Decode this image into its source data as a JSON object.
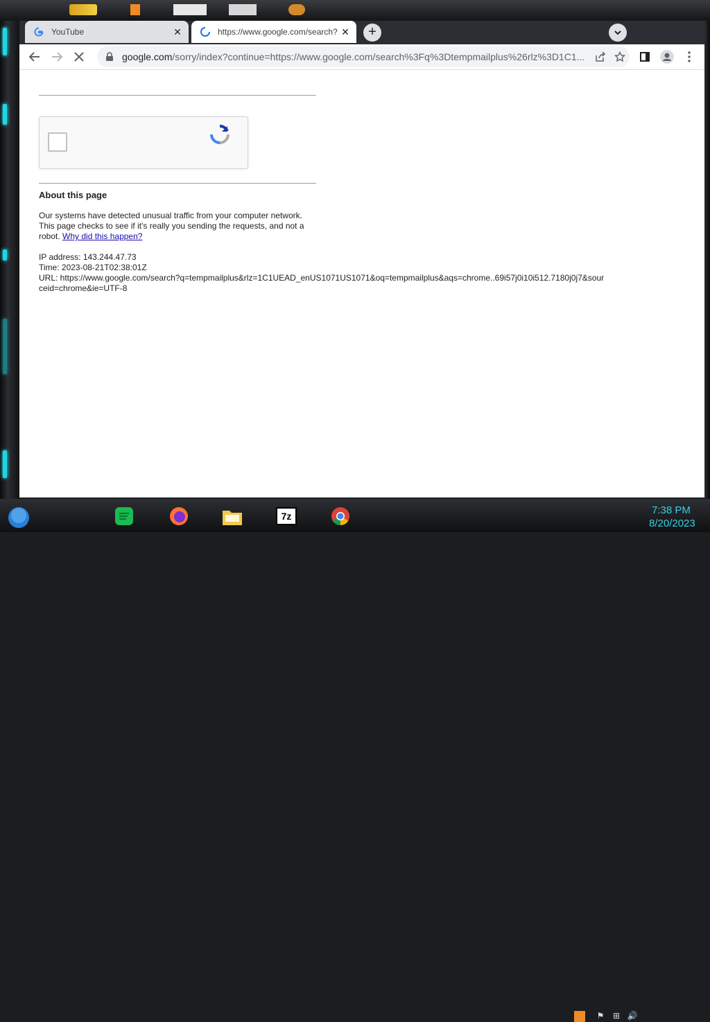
{
  "tabs": [
    {
      "title": "YouTube",
      "favicon": "google-g-icon"
    },
    {
      "title": "https://www.google.com/search?",
      "favicon": "loading-spinner-icon"
    }
  ],
  "tab_close_glyph": "✕",
  "new_tab_glyph": "+",
  "address_bar": {
    "host": "google.com",
    "path": "/sorry/index?continue=https://www.google.com/search%3Fq%3Dtempmailplus%26rlz%3D1C1..."
  },
  "page": {
    "about_heading": "About this page",
    "message_text": "Our systems have detected unusual traffic from your computer network. This page checks to see if it's really you sending the requests, and not a robot.",
    "why_link": "Why did this happen?",
    "ip_line": "IP address: 143.244.47.73",
    "time_line": "Time: 2023-08-21T02:38:01Z",
    "url_line": "URL: https://www.google.com/search?q=tempmailplus&rlz=1C1UEAD_enUS1071US1071&oq=tempmailplus&aqs=chrome..69i57j0i10i512.7180j0j7&sourceid=chrome&ie=UTF-8"
  },
  "taskbar": {
    "items": [
      "start-orb-icon",
      "spotify-icon",
      "firefox-icon",
      "file-explorer-icon",
      "7zip-icon",
      "chrome-icon"
    ],
    "sevenzip_label": "7z"
  },
  "clock": {
    "time": "7:38 PM",
    "date": "8/20/2023"
  },
  "colors": {
    "accent": "#33d1e6",
    "link": "#1a0dab",
    "google_blue": "#1a73e8"
  }
}
